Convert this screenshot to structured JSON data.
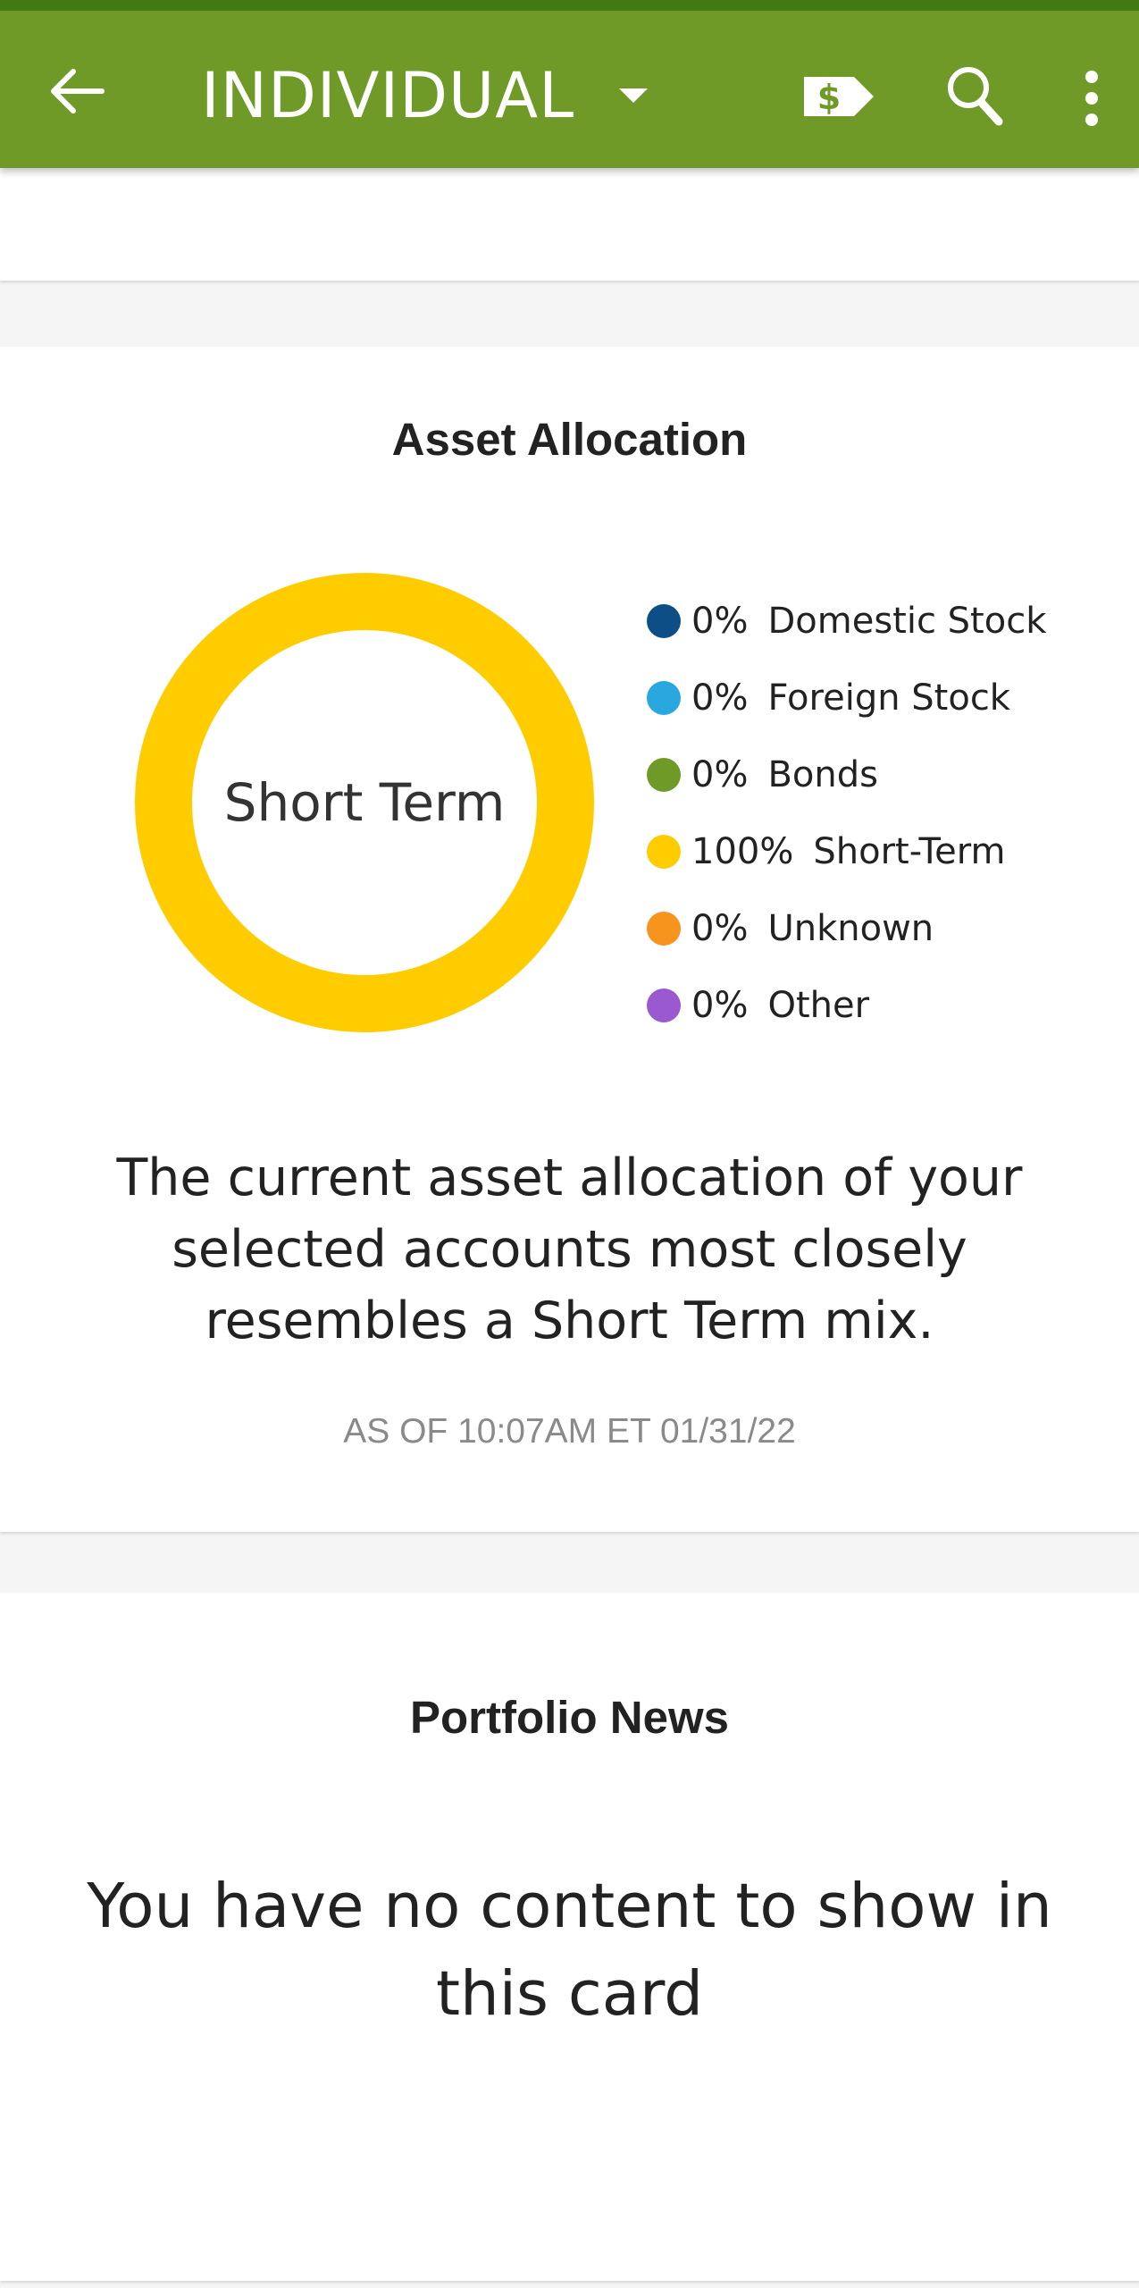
{
  "appbar": {
    "title": "INDIVIDUAL",
    "icons": [
      "back-arrow-icon",
      "dropdown-caret-icon",
      "dollar-tag-icon",
      "search-icon",
      "more-vert-icon"
    ],
    "color": "#6f9a27"
  },
  "asset_allocation": {
    "title": "Asset Allocation",
    "center_label": "Short Term",
    "legend": [
      {
        "pct": "0%",
        "label": "Domestic Stock",
        "color": "#0b4f86"
      },
      {
        "pct": "0%",
        "label": "Foreign Stock",
        "color": "#29a8e0"
      },
      {
        "pct": "0%",
        "label": "Bonds",
        "color": "#6f9a27"
      },
      {
        "pct": "100%",
        "label": "Short-Term",
        "color": "#ffcc00"
      },
      {
        "pct": "0%",
        "label": "Unknown",
        "color": "#f7941d"
      },
      {
        "pct": "0%",
        "label": "Other",
        "color": "#9b59d0"
      }
    ],
    "chart_data": {
      "type": "pie",
      "categories": [
        "Domestic Stock",
        "Foreign Stock",
        "Bonds",
        "Short-Term",
        "Unknown",
        "Other"
      ],
      "values": [
        0,
        0,
        0,
        100,
        0,
        0
      ],
      "center_label": "Short Term"
    },
    "summary": "The current asset allocation of your selected accounts most closely resembles a Short Term mix.",
    "as_of": "AS OF 10:07AM ET 01/31/22"
  },
  "portfolio_news": {
    "title": "Portfolio News",
    "empty_message": "You have no content to show in this card"
  }
}
